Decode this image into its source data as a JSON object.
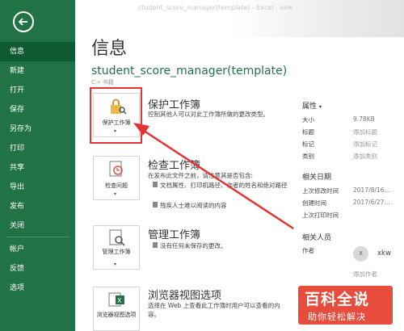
{
  "window": {
    "title": "student_score_manager(template) - Excel",
    "user": "xkw"
  },
  "sidebar": {
    "items": [
      {
        "label": "信息"
      },
      {
        "label": "新建"
      },
      {
        "label": "打开"
      },
      {
        "label": "保存"
      },
      {
        "label": "另存为"
      },
      {
        "label": "打印"
      },
      {
        "label": "共享"
      },
      {
        "label": "导出"
      },
      {
        "label": "发布"
      },
      {
        "label": "关闭"
      },
      {
        "label": "帐户"
      },
      {
        "label": "反馈"
      },
      {
        "label": "选项"
      }
    ]
  },
  "main": {
    "page_title": "信息",
    "doc_title": "student_score_manager(template)",
    "doc_path": "C:» 书籍"
  },
  "sections": {
    "protect": {
      "tile_label": "保护工作簿",
      "title": "保护工作簿",
      "desc": "控制其他人可以对此工作簿所做的更改类型。"
    },
    "inspect": {
      "tile_label": "检查问题",
      "title": "检查工作簿",
      "desc": "在发布此文件之前，请注意其是否包含:",
      "bullets": [
        "文档属性、打印机路径、作者的姓名和绝对路径",
        "残疾人士难以阅读的内容"
      ]
    },
    "manage": {
      "tile_label": "管理工作簿",
      "title": "管理工作簿",
      "desc": "没有任何未保存的更改。"
    },
    "browser": {
      "tile_label": "浏览器视图选项",
      "title": "浏览器视图选项",
      "desc": "选择在 Web 上查看此工作簿时用户可以查看的内容。"
    }
  },
  "properties": {
    "header": "属性",
    "items": [
      {
        "key": "大小",
        "value": "9.78KB"
      },
      {
        "key": "标题",
        "value": "添加标题"
      },
      {
        "key": "标记",
        "value": "添加标记"
      },
      {
        "key": "类别",
        "value": "添加类别"
      }
    ]
  },
  "dates": {
    "header": "相关日期",
    "items": [
      {
        "key": "上次修改时间",
        "value": "2017/8/16..."
      },
      {
        "key": "创建时间",
        "value": "2017/6/27..."
      },
      {
        "key": "上次打印时间",
        "value": ""
      }
    ]
  },
  "people": {
    "header": "相关人员",
    "author_key": "作者",
    "author_name": "xkw",
    "avatar_initial": "X",
    "add_author": "添加作者"
  },
  "watermark": {
    "big": "百科全说",
    "small": "助你轻松解决"
  },
  "colors": {
    "sidebar": "#217346",
    "sidebar_active": "#0f5a32",
    "highlight": "#e63232",
    "arrow": "#e63232"
  }
}
